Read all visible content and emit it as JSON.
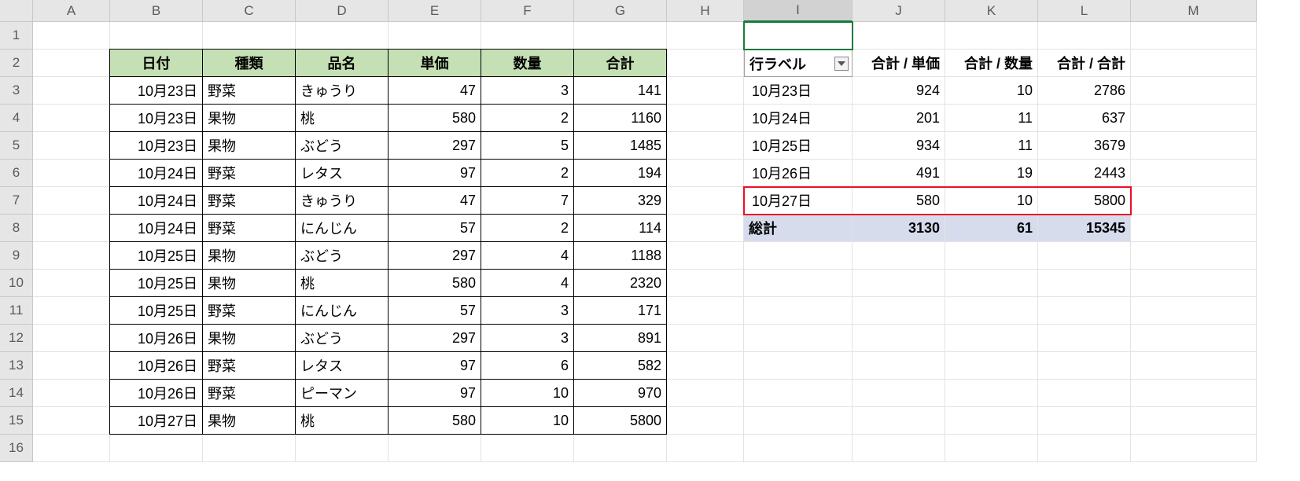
{
  "columns": [
    "A",
    "B",
    "C",
    "D",
    "E",
    "F",
    "G",
    "H",
    "I",
    "J",
    "K",
    "L",
    "M"
  ],
  "selected_column": "I",
  "row_count": 16,
  "active_cell": {
    "row": 1,
    "col": "I"
  },
  "source_table": {
    "range_start": {
      "row": 2,
      "col": "B"
    },
    "headers": [
      "日付",
      "種類",
      "品名",
      "単価",
      "数量",
      "合計"
    ],
    "rows": [
      {
        "date": "10月23日",
        "cat": "野菜",
        "item": "きゅうり",
        "unit": 47,
        "qty": 3,
        "total": 141
      },
      {
        "date": "10月23日",
        "cat": "果物",
        "item": "桃",
        "unit": 580,
        "qty": 2,
        "total": 1160
      },
      {
        "date": "10月23日",
        "cat": "果物",
        "item": "ぶどう",
        "unit": 297,
        "qty": 5,
        "total": 1485
      },
      {
        "date": "10月24日",
        "cat": "野菜",
        "item": "レタス",
        "unit": 97,
        "qty": 2,
        "total": 194
      },
      {
        "date": "10月24日",
        "cat": "野菜",
        "item": "きゅうり",
        "unit": 47,
        "qty": 7,
        "total": 329
      },
      {
        "date": "10月24日",
        "cat": "野菜",
        "item": "にんじん",
        "unit": 57,
        "qty": 2,
        "total": 114
      },
      {
        "date": "10月25日",
        "cat": "果物",
        "item": "ぶどう",
        "unit": 297,
        "qty": 4,
        "total": 1188
      },
      {
        "date": "10月25日",
        "cat": "果物",
        "item": "桃",
        "unit": 580,
        "qty": 4,
        "total": 2320
      },
      {
        "date": "10月25日",
        "cat": "野菜",
        "item": "にんじん",
        "unit": 57,
        "qty": 3,
        "total": 171
      },
      {
        "date": "10月26日",
        "cat": "果物",
        "item": "ぶどう",
        "unit": 297,
        "qty": 3,
        "total": 891
      },
      {
        "date": "10月26日",
        "cat": "野菜",
        "item": "レタス",
        "unit": 97,
        "qty": 6,
        "total": 582
      },
      {
        "date": "10月26日",
        "cat": "野菜",
        "item": "ピーマン",
        "unit": 97,
        "qty": 10,
        "total": 970
      },
      {
        "date": "10月27日",
        "cat": "果物",
        "item": "桃",
        "unit": 580,
        "qty": 10,
        "total": 5800
      }
    ]
  },
  "pivot": {
    "row_label": "行ラベル",
    "value_headers": [
      "合計 / 単価",
      "合計 / 数量",
      "合計 / 合計"
    ],
    "rows": [
      {
        "label": "10月23日",
        "unit": 924,
        "qty": 10,
        "total": 2786
      },
      {
        "label": "10月24日",
        "unit": 201,
        "qty": 11,
        "total": 637
      },
      {
        "label": "10月25日",
        "unit": 934,
        "qty": 11,
        "total": 3679
      },
      {
        "label": "10月26日",
        "unit": 491,
        "qty": 19,
        "total": 2443
      },
      {
        "label": "10月27日",
        "unit": 580,
        "qty": 10,
        "total": 5800
      }
    ],
    "grand": {
      "label": "総計",
      "unit": 3130,
      "qty": 61,
      "total": 15345
    },
    "highlight_row_index": 4
  }
}
